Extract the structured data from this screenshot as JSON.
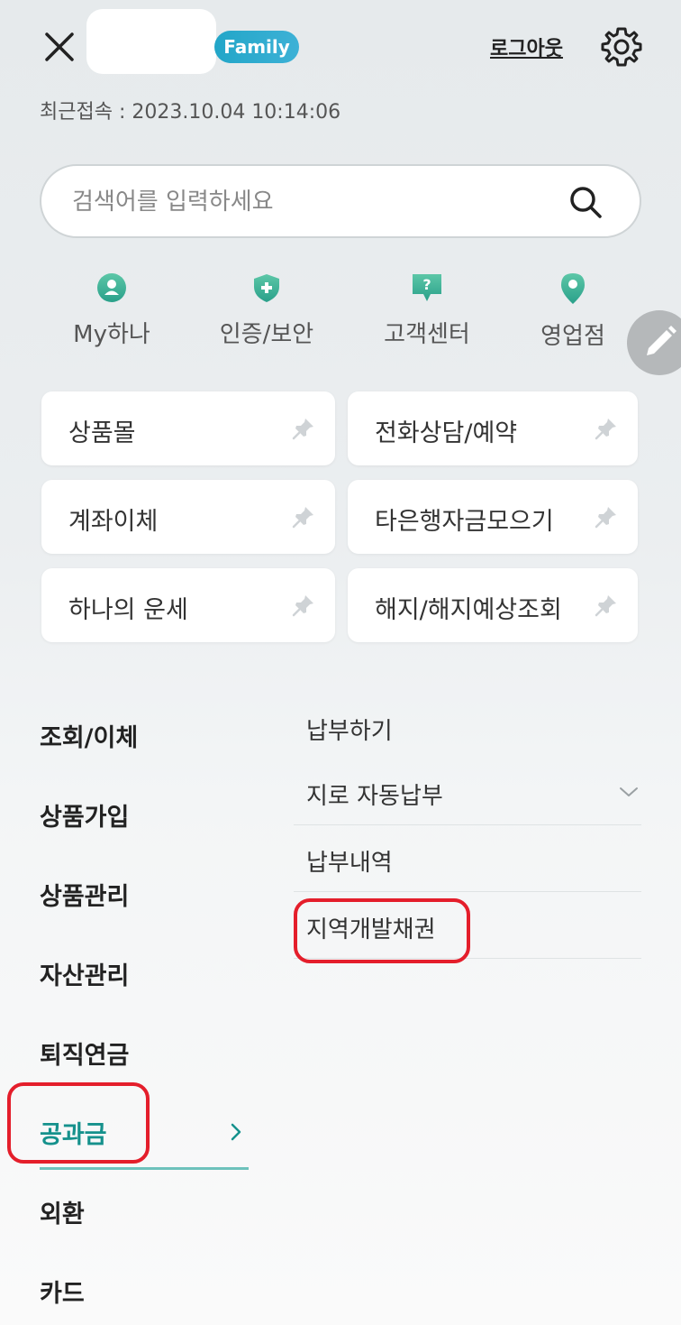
{
  "header": {
    "badge": "Family",
    "logout_label": "로그아웃",
    "last_login": "최근접속 : 2023.10.04 10:14:06"
  },
  "search": {
    "placeholder": "검색어를 입력하세요"
  },
  "quick_menu": [
    {
      "label": "My하나",
      "icon": "person-icon"
    },
    {
      "label": "인증/보안",
      "icon": "shield-plus-icon"
    },
    {
      "label": "고객센터",
      "icon": "question-chat-icon"
    },
    {
      "label": "영업점",
      "icon": "location-pin-icon"
    }
  ],
  "shortcuts": [
    {
      "label": "상품몰"
    },
    {
      "label": "전화상담/예약"
    },
    {
      "label": "계좌이체"
    },
    {
      "label": "타은행자금모으기"
    },
    {
      "label": "하나의 운세"
    },
    {
      "label": "해지/해지예상조회"
    }
  ],
  "categories": [
    {
      "label": "조회/이체"
    },
    {
      "label": "상품가입"
    },
    {
      "label": "상품관리"
    },
    {
      "label": "자산관리"
    },
    {
      "label": "퇴직연금"
    },
    {
      "label": "공과금",
      "active": true
    },
    {
      "label": "외환"
    },
    {
      "label": "카드"
    }
  ],
  "sub_items": [
    {
      "label": "납부하기"
    },
    {
      "label": "지로 자동납부",
      "expandable": true
    },
    {
      "label": "납부내역"
    },
    {
      "label": "지역개발채권"
    }
  ],
  "colors": {
    "accent": "#15918c",
    "badge": "#2aa9cf",
    "highlight": "#e41e2b",
    "icon_teal": "#3fb59a"
  }
}
